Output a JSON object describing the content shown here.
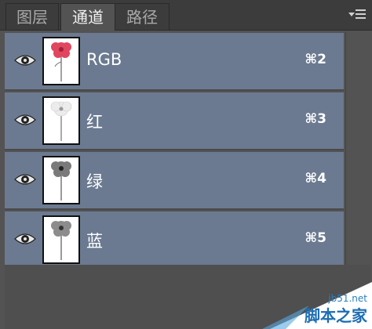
{
  "tabs": [
    {
      "label": "图层"
    },
    {
      "label": "通道"
    },
    {
      "label": "路径"
    }
  ],
  "channels": [
    {
      "name": "RGB",
      "shortcut": "⌘2",
      "thumb_color": "#e0465e"
    },
    {
      "name": "红",
      "shortcut": "⌘3",
      "thumb_color": "#e6e6e6"
    },
    {
      "name": "绿",
      "shortcut": "⌘4",
      "thumb_color": "#7a7a7a"
    },
    {
      "name": "蓝",
      "shortcut": "⌘5",
      "thumb_color": "#8c8c8c"
    }
  ],
  "watermark": {
    "domain": "jb51.net",
    "name": "脚本之家"
  },
  "colors": {
    "row_bg": "#6b7a90",
    "panel_bg": "#535353",
    "tabbar_bg": "#3c3c3c"
  }
}
